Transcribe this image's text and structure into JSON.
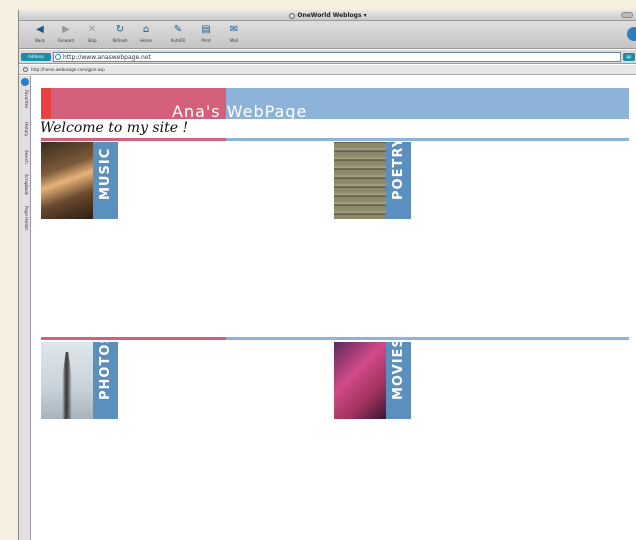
{
  "window": {
    "title": "OneWorld Weblogs"
  },
  "toolbar": {
    "buttons": [
      {
        "label": "Back"
      },
      {
        "label": "Forward"
      },
      {
        "label": "Stop"
      },
      {
        "label": "Refresh"
      },
      {
        "label": "Home"
      },
      {
        "label": "AutoFill"
      },
      {
        "label": "Print"
      },
      {
        "label": "Mail"
      }
    ]
  },
  "address": {
    "label": "Address",
    "url": "http://www.anaswebpage.net",
    "go_label": "go"
  },
  "status": {
    "text": "http://home.webusage.com/gpre.asp"
  },
  "sidebar": {
    "tabs": [
      "Favorites",
      "History",
      "Search",
      "Scrapbook",
      "Page Holder"
    ]
  },
  "page": {
    "title": "Ana's WebPage",
    "welcome": "Welcome to my site !",
    "sections": [
      {
        "label": "MUSIC"
      },
      {
        "label": "POETRY"
      },
      {
        "label": "PHOTOS"
      },
      {
        "label": "MOVIES"
      }
    ]
  },
  "colors": {
    "accent_red": "#e8403f",
    "accent_pink": "#d35f7b",
    "accent_blue": "#8db3d8",
    "tile_band": "#5b8fbe"
  }
}
